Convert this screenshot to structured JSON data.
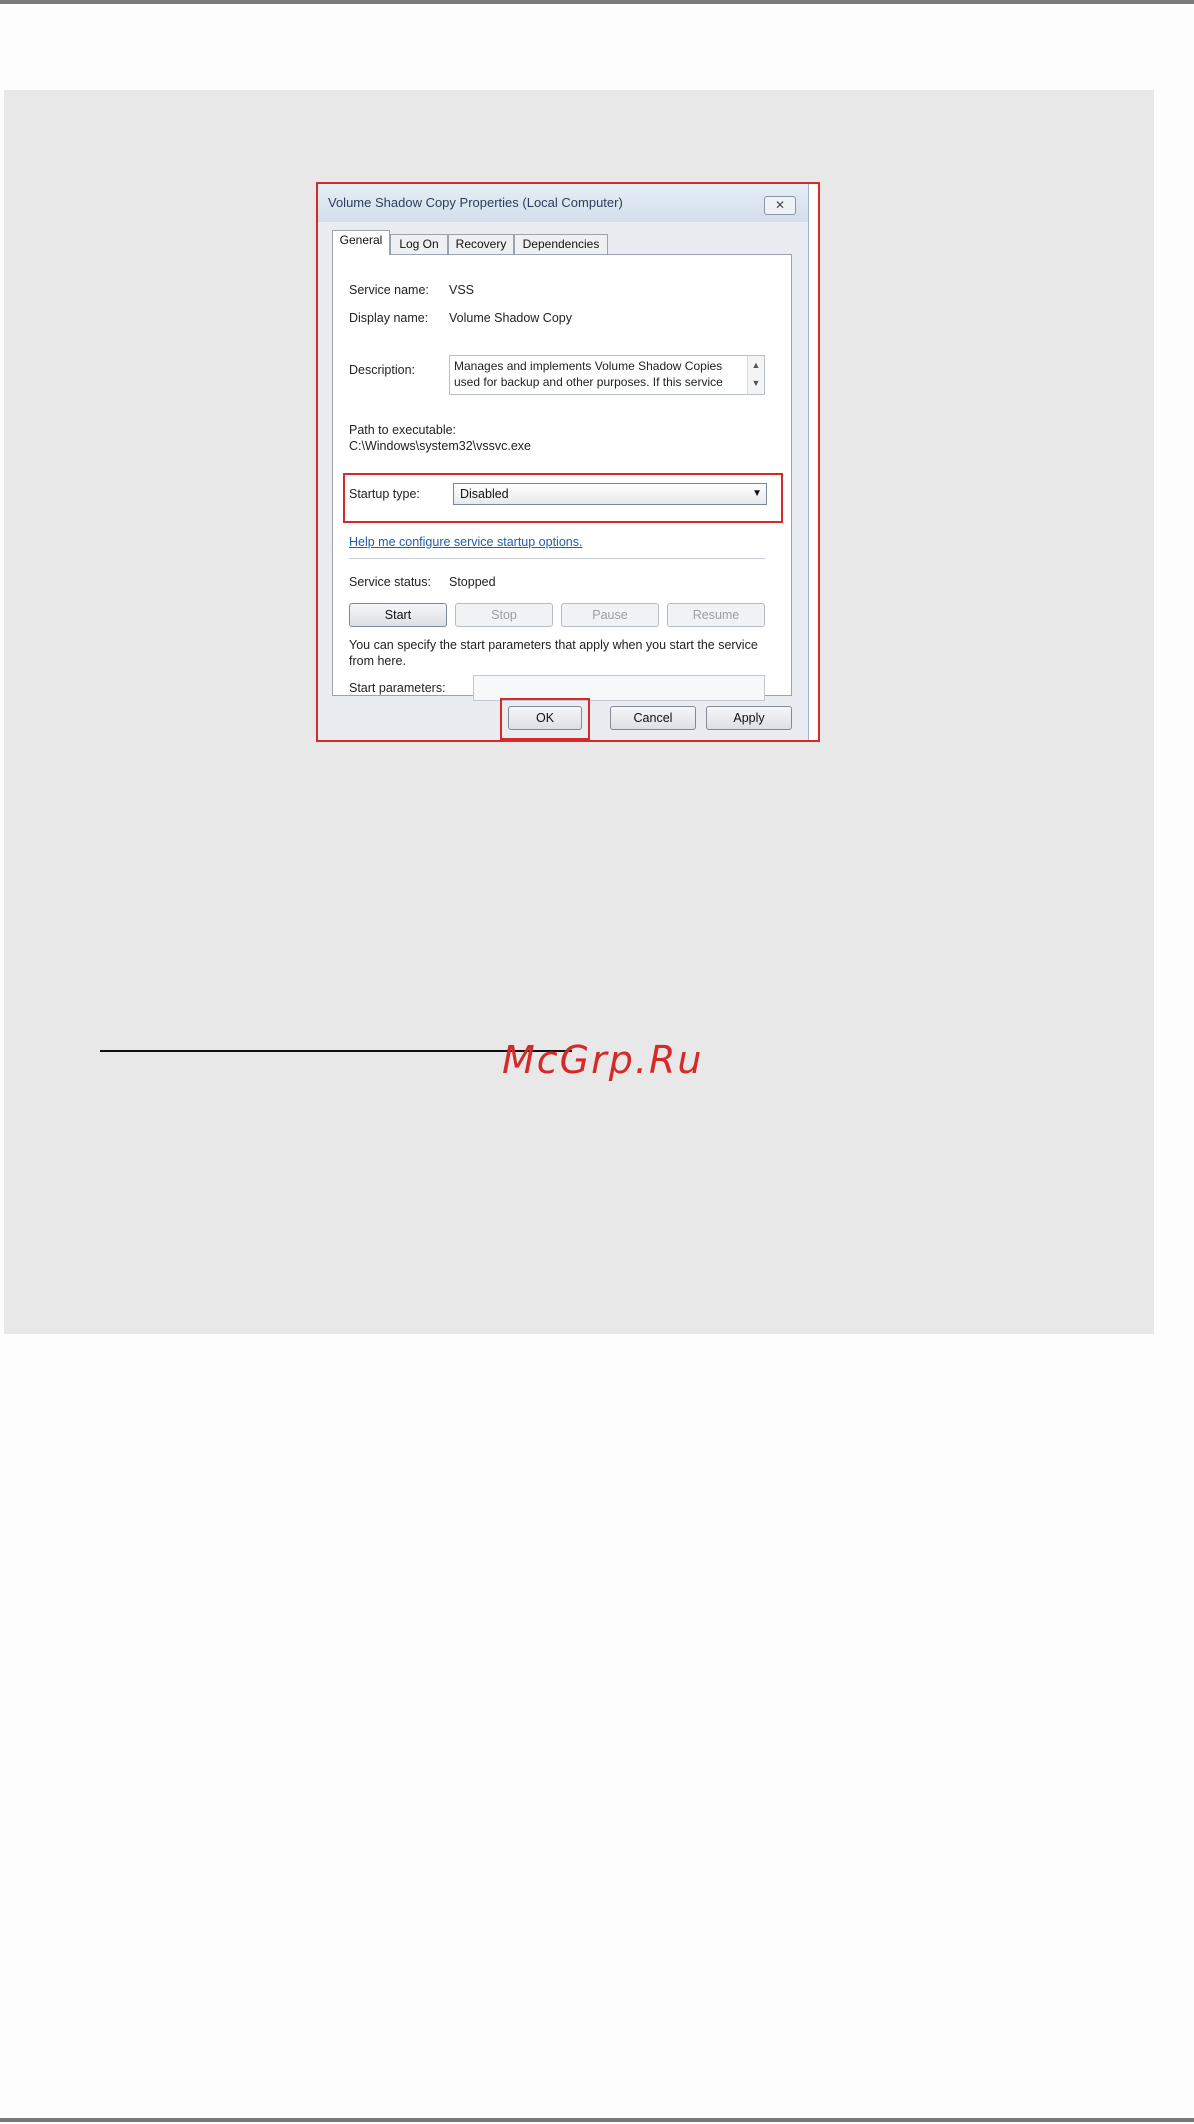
{
  "dialog": {
    "title": "Volume Shadow Copy Properties (Local Computer)",
    "close_glyph": "✕",
    "tabs": [
      {
        "label": "General",
        "active": true
      },
      {
        "label": "Log On",
        "active": false
      },
      {
        "label": "Recovery",
        "active": false
      },
      {
        "label": "Dependencies",
        "active": false
      }
    ],
    "general": {
      "service_name_label": "Service name:",
      "service_name_value": "VSS",
      "display_name_label": "Display name:",
      "display_name_value": "Volume Shadow Copy",
      "description_label": "Description:",
      "description_value": "Manages and implements Volume Shadow Copies used for backup and other purposes. If this service",
      "path_label": "Path to executable:",
      "path_value": "C:\\Windows\\system32\\vssvc.exe",
      "startup_type_label": "Startup type:",
      "startup_type_value": "Disabled",
      "help_link": "Help me configure service startup options.",
      "service_status_label": "Service status:",
      "service_status_value": "Stopped",
      "start_button": "Start",
      "stop_button": "Stop",
      "pause_button": "Pause",
      "resume_button": "Resume",
      "params_hint": "You can specify the start parameters that apply when you start the service from here.",
      "start_params_label": "Start parameters:",
      "start_params_value": ""
    },
    "footer": {
      "ok_button": "OK",
      "cancel_button": "Cancel",
      "apply_button": "Apply"
    },
    "highlight_color": "#d42a2a"
  },
  "watermark": "McGrp.Ru"
}
